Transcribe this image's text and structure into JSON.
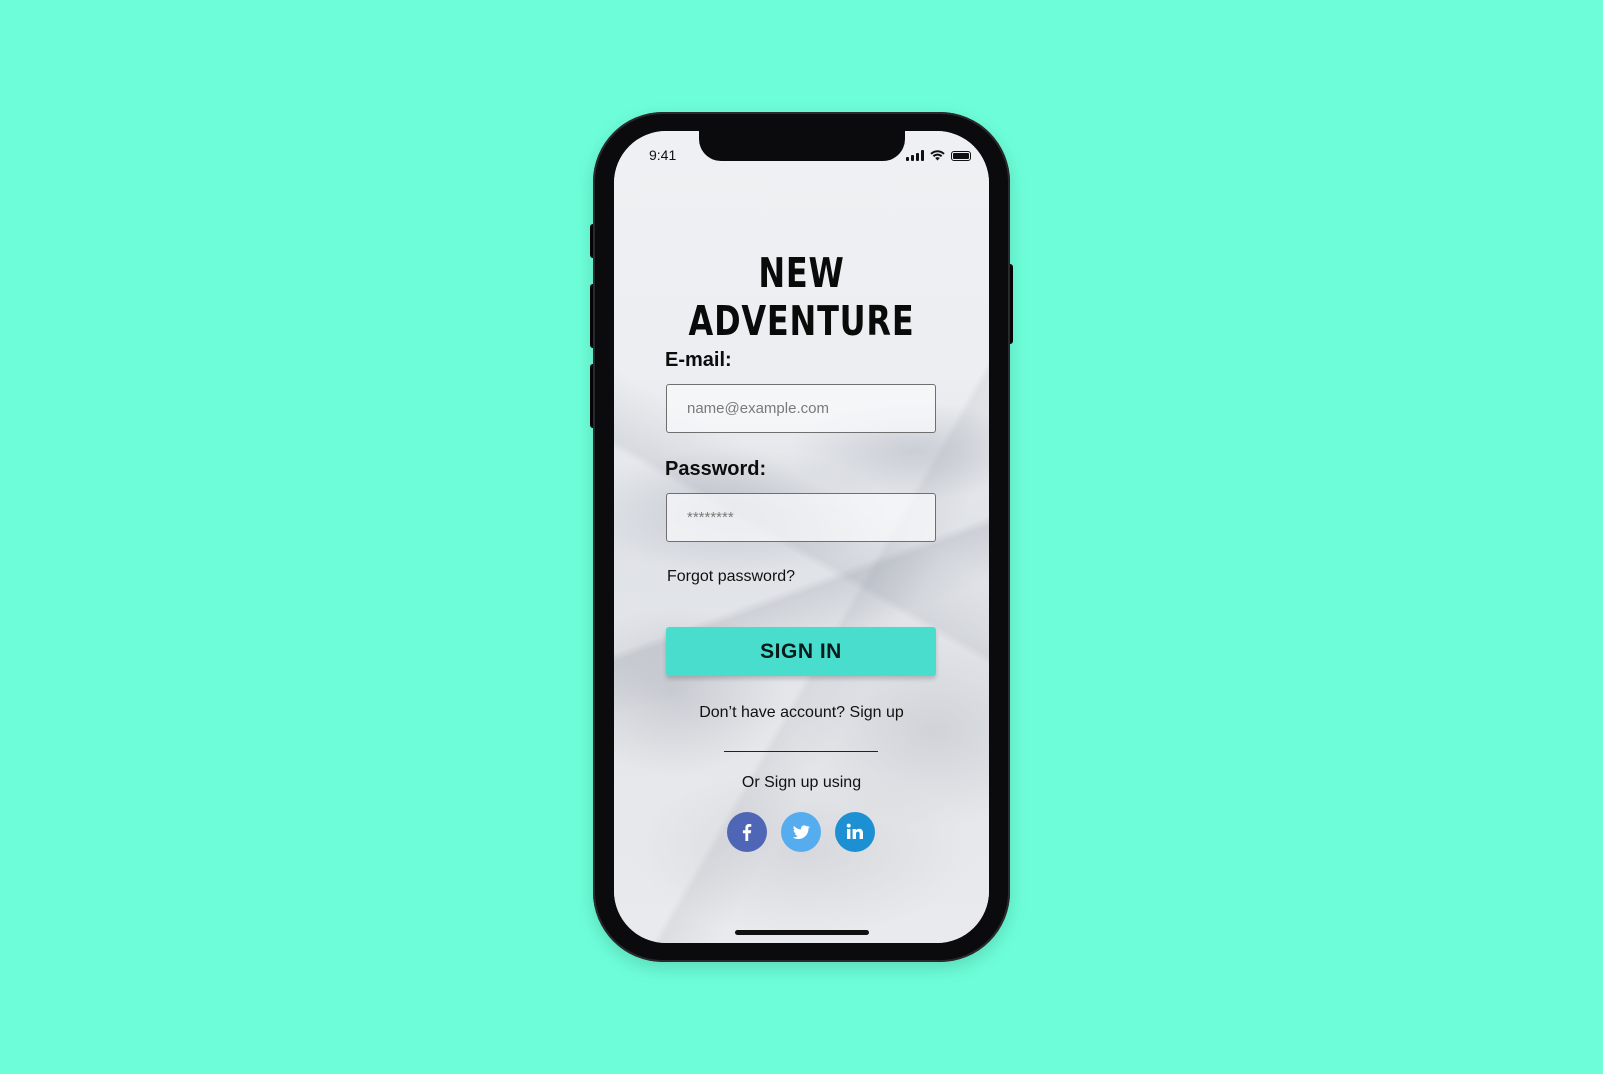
{
  "status_bar": {
    "time": "9:41",
    "icons": [
      "signal-icon",
      "wifi-icon",
      "battery-icon"
    ]
  },
  "app": {
    "title": "NEW ADVENTURE"
  },
  "form": {
    "email_label": "E-mail:",
    "email_placeholder": "name@example.com",
    "email_value": "",
    "password_label": "Password:",
    "password_placeholder": "********",
    "password_value": "",
    "forgot_label": "Forgot password?",
    "signin_label": "SIGN IN"
  },
  "signup": {
    "prompt": "Don’t have account? Sign up",
    "social_prompt": "Or Sign up using",
    "providers": [
      {
        "name": "facebook",
        "icon": "facebook-icon",
        "color": "#4e66b5"
      },
      {
        "name": "twitter",
        "icon": "twitter-icon",
        "color": "#55acee"
      },
      {
        "name": "linkedin",
        "icon": "linkedin-icon",
        "color": "#1d8fd3"
      }
    ]
  },
  "colors": {
    "background": "#6dfed9",
    "accent": "#48ddcc"
  }
}
